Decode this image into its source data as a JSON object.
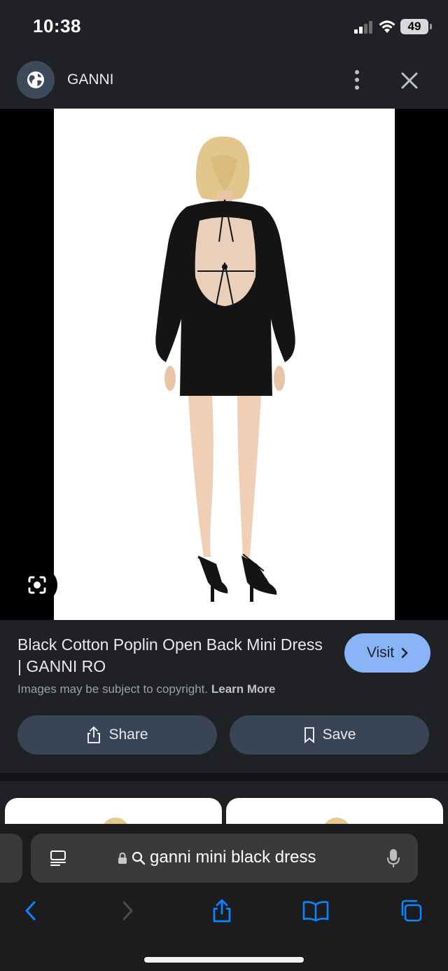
{
  "status": {
    "time": "10:38",
    "battery": "49"
  },
  "header": {
    "site_name": "GANNI",
    "icons": [
      "globe-icon",
      "more-vert-icon",
      "close-icon"
    ]
  },
  "image": {
    "lens_icon": "google-lens-icon"
  },
  "result": {
    "title": "Black Cotton Poplin Open Back Mini Dress | GANNI RO",
    "visit_label": "Visit",
    "copyright_text": "Images may be subject to copyright.",
    "learn_more": "Learn More",
    "share_label": "Share",
    "save_label": "Save"
  },
  "browser": {
    "url_text": "ganni mini black dress",
    "icons": [
      "reader-icon",
      "lock-icon",
      "search-icon",
      "microphone-icon",
      "back-icon",
      "forward-icon",
      "share-icon",
      "bookmarks-icon",
      "tabs-icon"
    ]
  },
  "colors": {
    "background": "#202124",
    "visit_button": "#8ab4f8",
    "action_button": "#394457",
    "safari_accent": "#0a84ff"
  }
}
